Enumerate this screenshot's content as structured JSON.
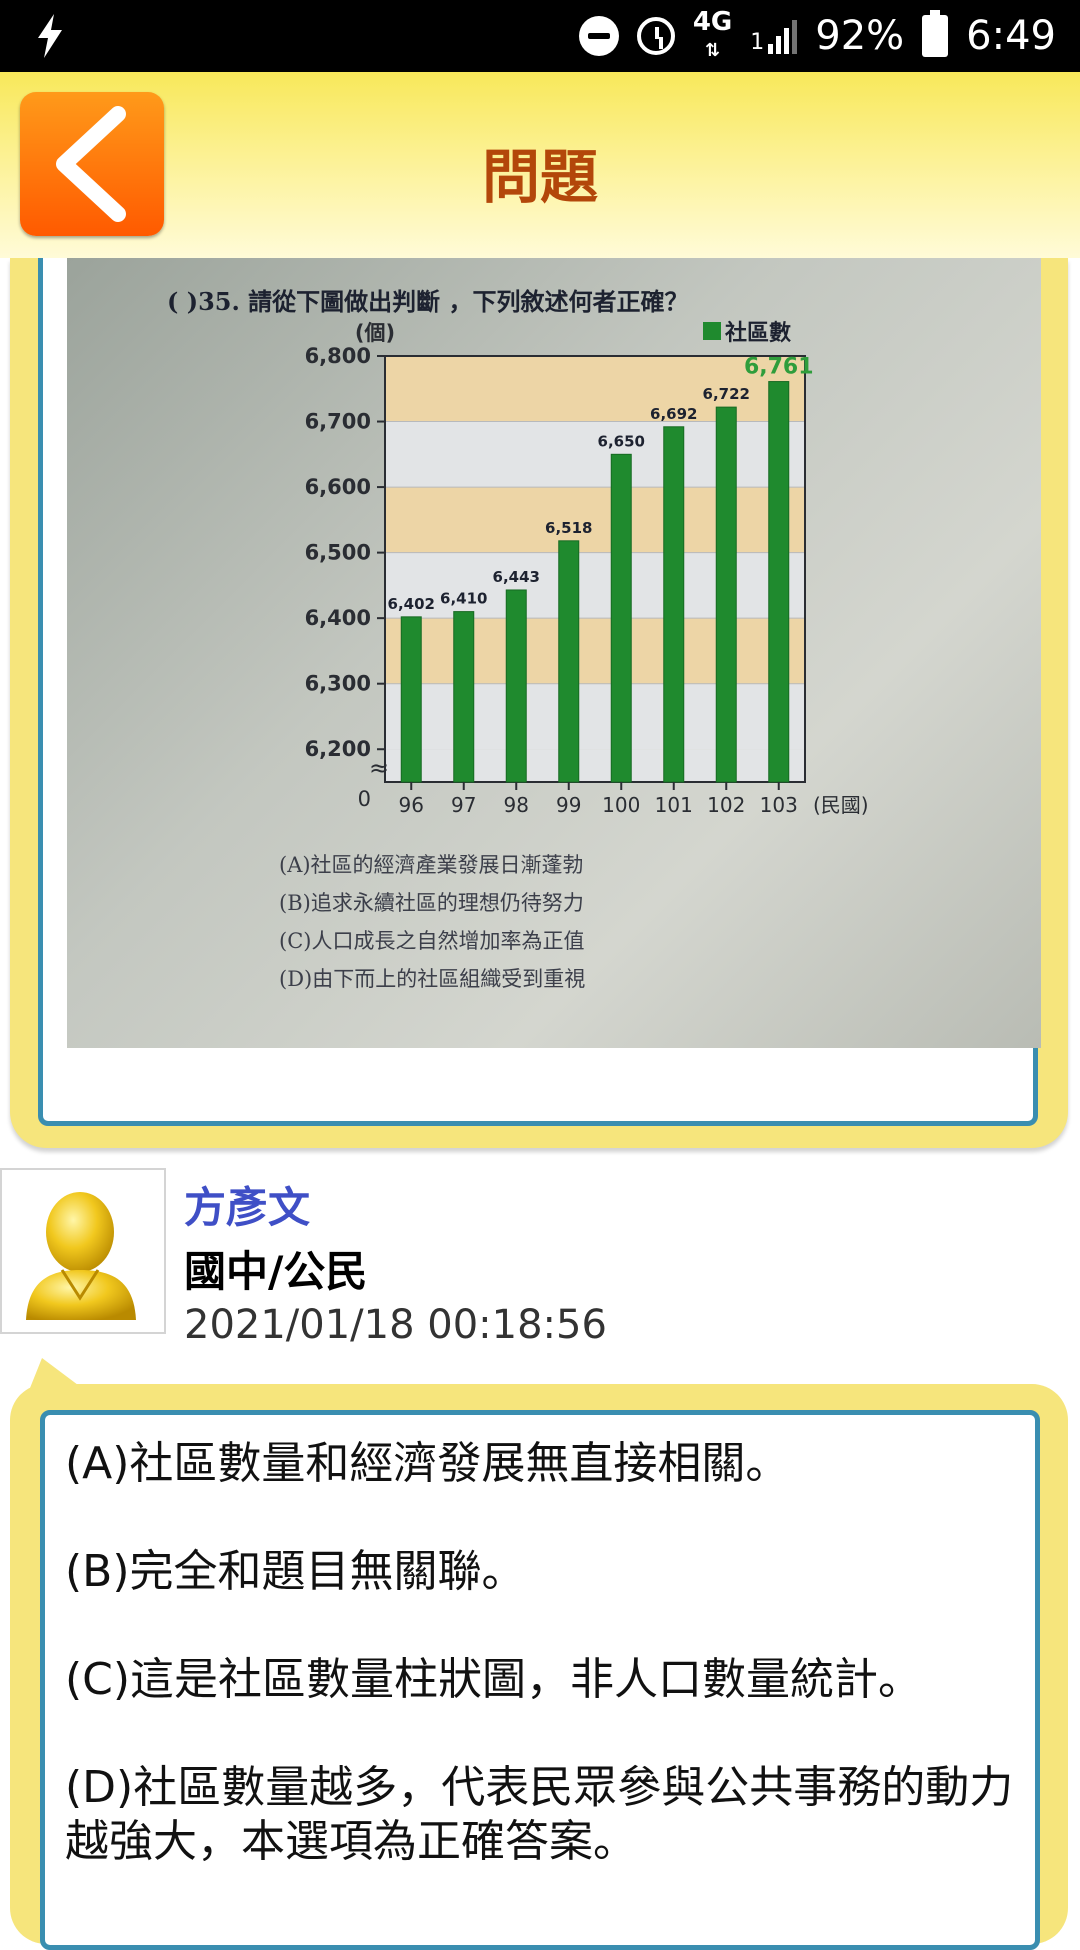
{
  "status_bar": {
    "network": "4G",
    "network_sub": "1",
    "battery": "92%",
    "time": "6:49",
    "icons": [
      "flash-icon",
      "do-not-disturb-icon",
      "alarm-icon",
      "4g-icon",
      "signal-icon",
      "battery-icon"
    ]
  },
  "header": {
    "title": "問題",
    "back_icon": "chevron-left-icon",
    "colors": {
      "bar": "#f8e85a",
      "title": "#b3470a",
      "back_button": "#ff6a00"
    }
  },
  "question": {
    "text": "(      )35. 請從下圖做出判斷 ，下列敘述何者正確？",
    "options": [
      "(A)社區的經濟產業發展日漸蓬勃",
      "(B)追求永續社區的理想仍待努力",
      "(C)人口成長之自然增加率為正值",
      "(D)由下而上的社區組織受到重視"
    ]
  },
  "chart_data": {
    "type": "bar",
    "categories": [
      "96",
      "97",
      "98",
      "99",
      "100",
      "101",
      "102",
      "103"
    ],
    "series": [
      {
        "name": "社區數",
        "values": [
          6402,
          6410,
          6443,
          6518,
          6650,
          6692,
          6722,
          6761
        ]
      }
    ],
    "data_labels": [
      "6,402",
      "6,410",
      "6,443",
      "6,518",
      "6,650",
      "6,692",
      "6,722",
      "6,761"
    ],
    "y_ticks": [
      "6,800",
      "6,700",
      "6,600",
      "6,500",
      "6,400",
      "6,300",
      "6,200",
      "0"
    ],
    "ylabel": "(個)",
    "xlabel": "(民國)",
    "ylim": [
      6150,
      6800
    ],
    "legend": "社區數",
    "legend_position": "top-right",
    "bar_color": "#1f8a2e",
    "band_color": "#edd5a6"
  },
  "answer": {
    "author": "方彥文",
    "category": "國中/公民",
    "timestamp": "2021/01/18 00:18:56",
    "avatar_icon": "user-avatar-icon",
    "lines": [
      "(A)社區數量和經濟發展無直接相關。",
      "(B)完全和題目無關聯。",
      "(C)這是社區數量柱狀圖，非人口數量統計。",
      "(D)社區數量越多，代表民眾參與公共事務的動力越強大，本選項為正確答案。"
    ]
  },
  "colors": {
    "card_bg": "#f6e57c",
    "card_border": "#3a8eb0",
    "author_name": "#3f4fc6"
  }
}
